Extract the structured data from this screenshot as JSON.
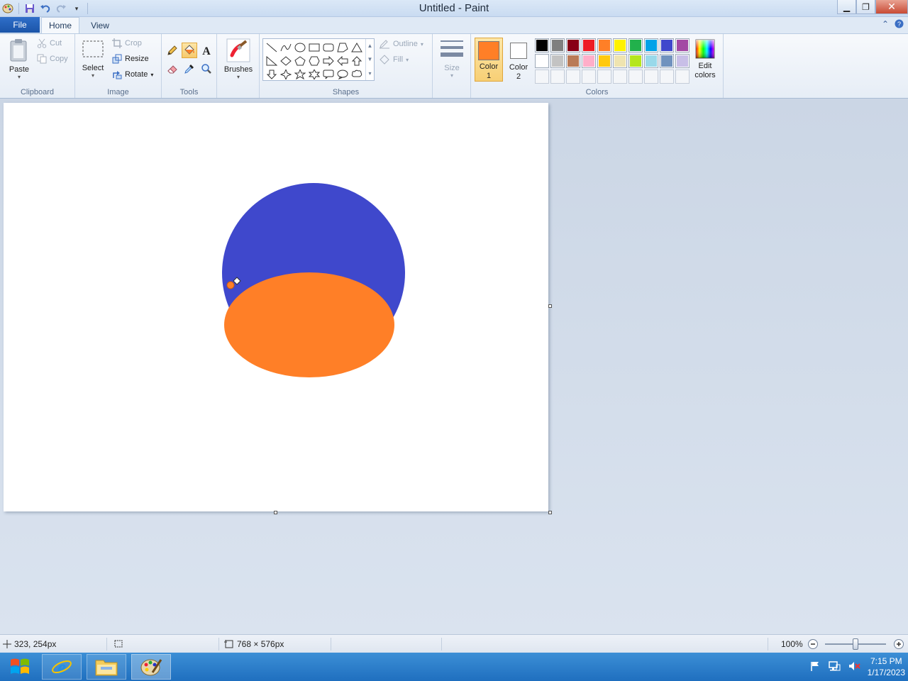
{
  "window": {
    "title": "Untitled - Paint"
  },
  "tabs": {
    "file": "File",
    "home": "Home",
    "view": "View"
  },
  "clipboard": {
    "paste": "Paste",
    "cut": "Cut",
    "copy": "Copy",
    "label": "Clipboard"
  },
  "image": {
    "select": "Select",
    "crop": "Crop",
    "resize": "Resize",
    "rotate": "Rotate",
    "label": "Image"
  },
  "tools": {
    "label": "Tools"
  },
  "brushes": {
    "label": "Brushes"
  },
  "shapes": {
    "outline": "Outline",
    "fill": "Fill",
    "label": "Shapes"
  },
  "size": {
    "label": "Size"
  },
  "colors": {
    "color1_label": "Color",
    "color1_num": "1",
    "color2_label": "Color",
    "color2_num": "2",
    "edit_label": "Edit",
    "edit_label2": "colors",
    "label": "Colors",
    "color1_value": "#ff7f27",
    "color2_value": "#ffffff",
    "palette_row1": [
      "#000000",
      "#7f7f7f",
      "#880015",
      "#ed1c24",
      "#ff7f27",
      "#fff200",
      "#22b14c",
      "#00a2e8",
      "#3f48cc",
      "#a349a4"
    ],
    "palette_row2": [
      "#ffffff",
      "#c3c3c3",
      "#b97a57",
      "#ffaec9",
      "#ffc90e",
      "#efe4b0",
      "#b5e61d",
      "#99d9ea",
      "#7092be",
      "#c8bfe7"
    ]
  },
  "canvas": {
    "circle_color": "#3f48cc",
    "ellipse_color": "#ff7f27"
  },
  "status": {
    "cursor_pos": "323, 254px",
    "image_size": "768 × 576px",
    "zoom": "100%"
  },
  "taskbar": {
    "time": "7:15 PM",
    "date": "1/17/2023"
  }
}
